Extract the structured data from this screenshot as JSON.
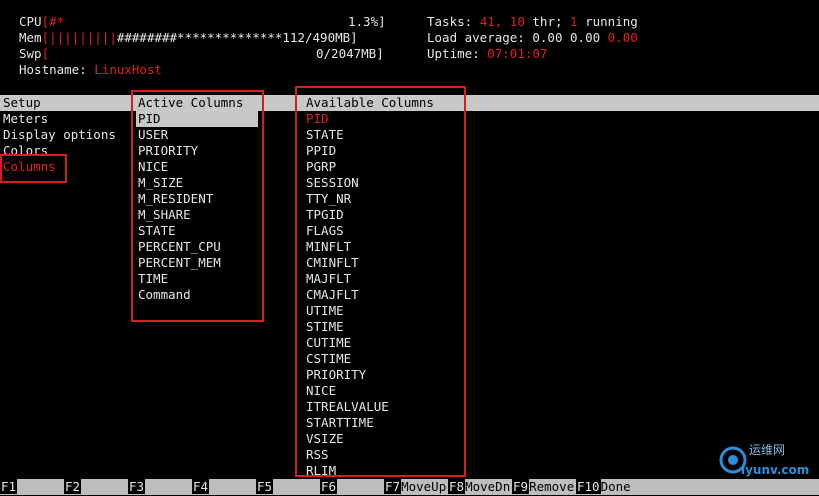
{
  "header": {
    "cpu_label": "CPU",
    "cpu_bar": "[",
    "cpu_bar_fill": "#*",
    "cpu_value": "1.3%]",
    "mem_label": "Mem",
    "mem_bar_open": "[",
    "mem_bar_fill": "|||||||||",
    "mem_bar_rest": "########**************",
    "mem_value": "112/490MB]",
    "swp_label": "Swp",
    "swp_bar_open": "[",
    "swp_value": "0/2047MB]",
    "hostname_label": "Hostname:",
    "hostname_value": "LinuxHost",
    "tasks_label": "Tasks:",
    "tasks_count": "41,",
    "threads_count": "10",
    "thr_label": "thr;",
    "running_count": "1",
    "running_label": "running",
    "load_label": "Load average:",
    "load_1": "0.00",
    "load_5": "0.00",
    "load_15": "0.00",
    "uptime_label": "Uptime:",
    "uptime_value": "07:01:07"
  },
  "setup": {
    "title": "Setup",
    "items": [
      "Meters",
      "Display options",
      "Colors",
      "Columns"
    ]
  },
  "active_columns": {
    "title": "Active Columns",
    "items": [
      "PID",
      "USER",
      "PRIORITY",
      "NICE",
      "M_SIZE",
      "M_RESIDENT",
      "M_SHARE",
      "STATE",
      "PERCENT_CPU",
      "PERCENT_MEM",
      "TIME",
      "Command"
    ]
  },
  "available_columns": {
    "title": "Available Columns",
    "items": [
      "PID",
      "STATE",
      "PPID",
      "PGRP",
      "SESSION",
      "TTY_NR",
      "TPGID",
      "FLAGS",
      "MINFLT",
      "CMINFLT",
      "MAJFLT",
      "CMAJFLT",
      "UTIME",
      "STIME",
      "CUTIME",
      "CSTIME",
      "PRIORITY",
      "NICE",
      "ITREALVALUE",
      "STARTTIME",
      "VSIZE",
      "RSS",
      "RLIM"
    ]
  },
  "function_keys": [
    {
      "key": "F1",
      "label": ""
    },
    {
      "key": "F2",
      "label": ""
    },
    {
      "key": "F3",
      "label": ""
    },
    {
      "key": "F4",
      "label": ""
    },
    {
      "key": "F5",
      "label": ""
    },
    {
      "key": "F6",
      "label": ""
    },
    {
      "key": "F7",
      "label": "MoveUp"
    },
    {
      "key": "F8",
      "label": "MoveDn"
    },
    {
      "key": "F9",
      "label": "Remove"
    },
    {
      "key": "F10",
      "label": "Done"
    }
  ],
  "watermark": {
    "line1": "运维网",
    "line2": "iyunv.com"
  },
  "colors": {
    "highlight_bar": "#c8c8c8",
    "accent_red": "#e02020",
    "background": "#000000"
  }
}
